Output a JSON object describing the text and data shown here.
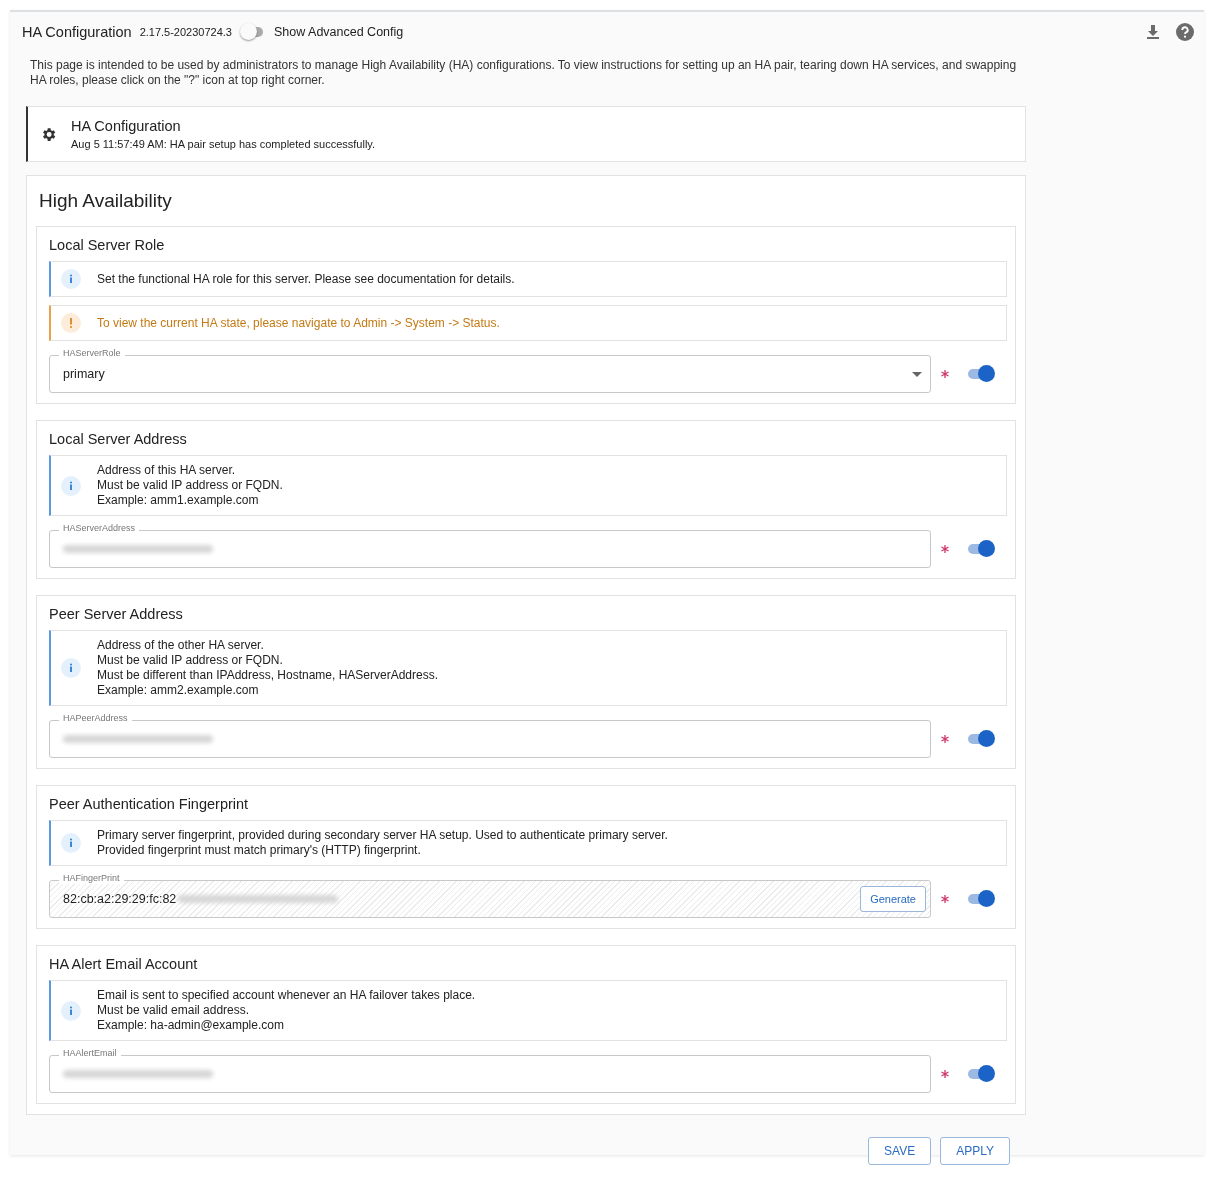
{
  "header": {
    "title": "HA Configuration",
    "version": "2.17.5-20230724.3",
    "advanced_toggle": {
      "label": "Show Advanced Config",
      "on": false
    }
  },
  "intro": "This page is intended to be used by administrators to manage High Availability (HA) configurations. To view instructions for setting up an HA pair, tearing down HA services, and swapping HA roles, please click on the \"?\" icon at top right corner.",
  "status_card": {
    "title": "HA Configuration",
    "message": "Aug 5 11:57:49 AM: HA pair setup has completed successfully."
  },
  "panel": {
    "title": "High Availability",
    "sections": [
      {
        "title": "Local Server Role",
        "notes": [
          {
            "kind": "info",
            "lines": [
              "Set the functional HA role for this server. Please see documentation for details."
            ]
          },
          {
            "kind": "warning",
            "lines": [
              "To view the current HA state, please navigate to Admin -> System -> Status."
            ]
          }
        ],
        "field": {
          "kind": "select",
          "label": "HAServerRole",
          "value": "primary",
          "required": true,
          "enabled": true
        }
      },
      {
        "title": "Local Server Address",
        "notes": [
          {
            "kind": "info",
            "lines": [
              "Address of this HA server.",
              "Must be valid IP address or FQDN.",
              "Example: amm1.example.com"
            ]
          }
        ],
        "field": {
          "kind": "text",
          "label": "HAServerAddress",
          "redacted": true,
          "required": true,
          "enabled": true
        }
      },
      {
        "title": "Peer Server Address",
        "notes": [
          {
            "kind": "info",
            "lines": [
              "Address of the other HA server.",
              "Must be valid IP address or FQDN.",
              "Must be different than IPAddress, Hostname, HAServerAddress.",
              "Example: amm2.example.com"
            ]
          }
        ],
        "field": {
          "kind": "text",
          "label": "HAPeerAddress",
          "redacted": true,
          "required": true,
          "enabled": true
        }
      },
      {
        "title": "Peer Authentication Fingerprint",
        "notes": [
          {
            "kind": "info",
            "lines": [
              "Primary server fingerprint, provided during secondary server HA setup. Used to authenticate primary server.",
              "Provided fingerprint must match primary's (HTTP) fingerprint."
            ]
          }
        ],
        "field": {
          "kind": "fingerprint",
          "label": "HAFingerPrint",
          "value": "82:cb:a2:29:29:fc:82",
          "redacted": true,
          "button": "Generate",
          "required": true,
          "enabled": true
        }
      },
      {
        "title": "HA Alert Email Account",
        "notes": [
          {
            "kind": "info",
            "lines": [
              "Email is sent to specified account whenever an HA failover takes place.",
              "Must be valid email address.",
              "Example: ha-admin@example.com"
            ]
          }
        ],
        "field": {
          "kind": "text",
          "label": "HAAlertEmail",
          "redacted": true,
          "required": true,
          "enabled": true
        }
      }
    ]
  },
  "buttons": [
    "SAVE",
    "APPLY"
  ]
}
